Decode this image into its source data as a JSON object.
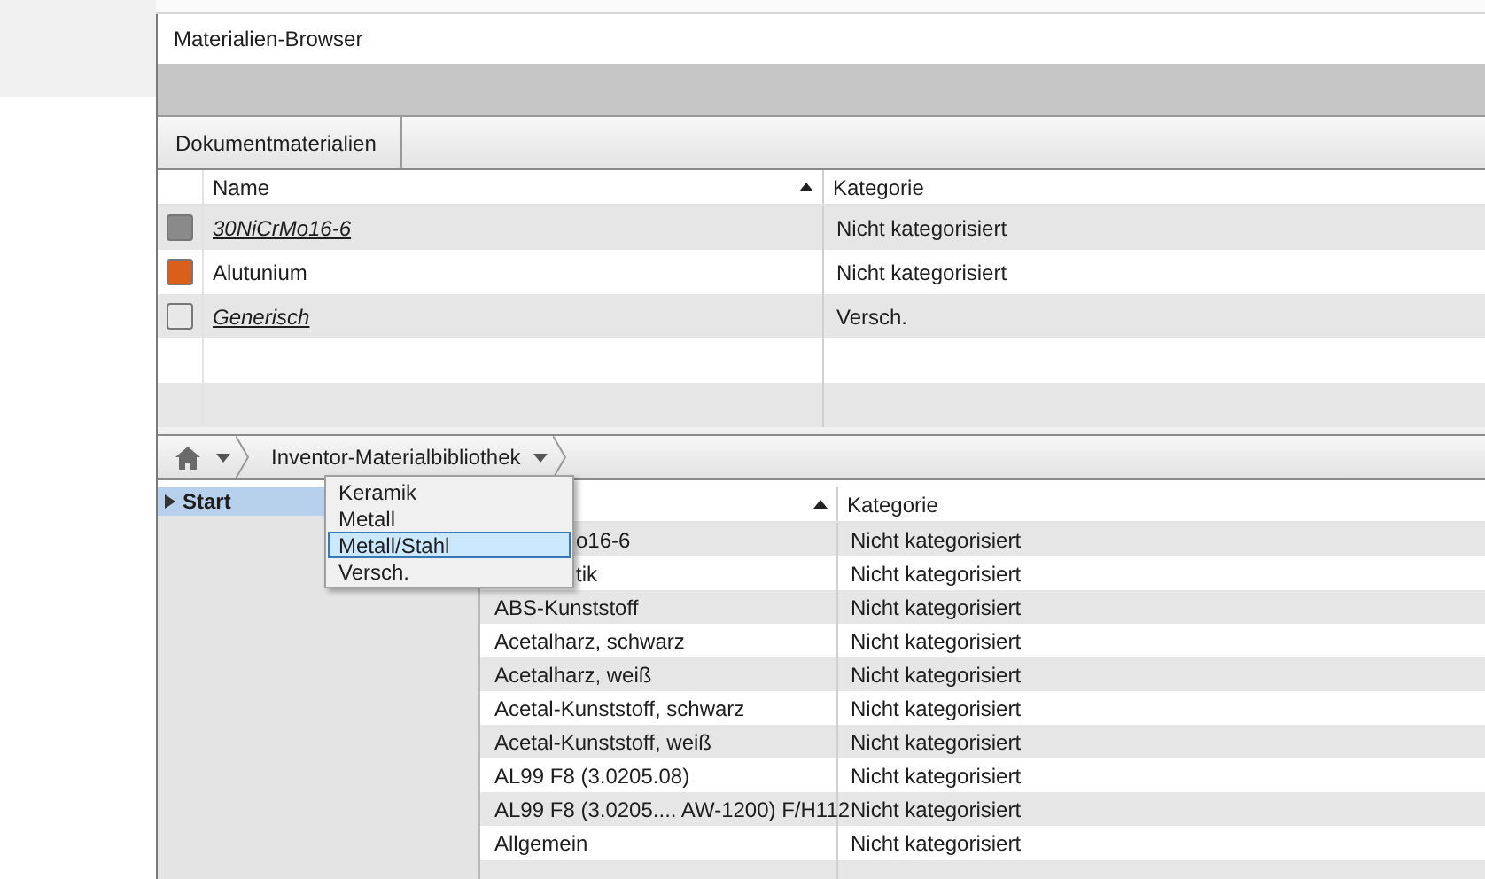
{
  "window": {
    "title": "Materialien-Browser"
  },
  "document_breadcrumb": {
    "label": "Dokumentmaterialien"
  },
  "document_table": {
    "columns": [
      "Name",
      "Kategorie"
    ],
    "sort_ascending": true,
    "rows": [
      {
        "name": "30NiCrMo16-6",
        "category": "Nicht kategorisiert",
        "color": "#8a8a8a",
        "italic": true
      },
      {
        "name": "Alutunium",
        "category": "Nicht kategorisiert",
        "color": "#d9601a",
        "italic": false
      },
      {
        "name": "Generisch",
        "category": "Versch.",
        "color": "#e8e8e8",
        "italic": true
      }
    ]
  },
  "library_bar": {
    "label": "Inventor-Materialbibliothek"
  },
  "tree": {
    "items": [
      {
        "label": "Start",
        "selected": true,
        "expanded": false
      }
    ]
  },
  "category_menu": {
    "items": [
      {
        "label": "Keramik",
        "selected": false
      },
      {
        "label": "Metall",
        "selected": false
      },
      {
        "label": "Metall/Stahl",
        "selected": true
      },
      {
        "label": "Versch.",
        "selected": false
      }
    ]
  },
  "library_table": {
    "columns": [
      "Kategorie"
    ],
    "sort_ascending": true,
    "rows": [
      {
        "name": "o16-6",
        "category": "Nicht kategorisiert"
      },
      {
        "name": "tik",
        "category": "Nicht kategorisiert"
      },
      {
        "name": "ABS-Kunststoff",
        "category": "Nicht kategorisiert"
      },
      {
        "name": "Acetalharz, schwarz",
        "category": "Nicht kategorisiert"
      },
      {
        "name": "Acetalharz, weiß",
        "category": "Nicht kategorisiert"
      },
      {
        "name": "Acetal-Kunststoff, schwarz",
        "category": "Nicht kategorisiert"
      },
      {
        "name": "Acetal-Kunststoff, weiß",
        "category": "Nicht kategorisiert"
      },
      {
        "name": "AL99 F8 (3.0205.08)",
        "category": "Nicht kategorisiert"
      },
      {
        "name": "AL99 F8 (3.0205.... AW-1200) F/H112",
        "category": "Nicht kategorisiert"
      },
      {
        "name": "Allgemein",
        "category": "Nicht kategorisiert"
      }
    ]
  }
}
